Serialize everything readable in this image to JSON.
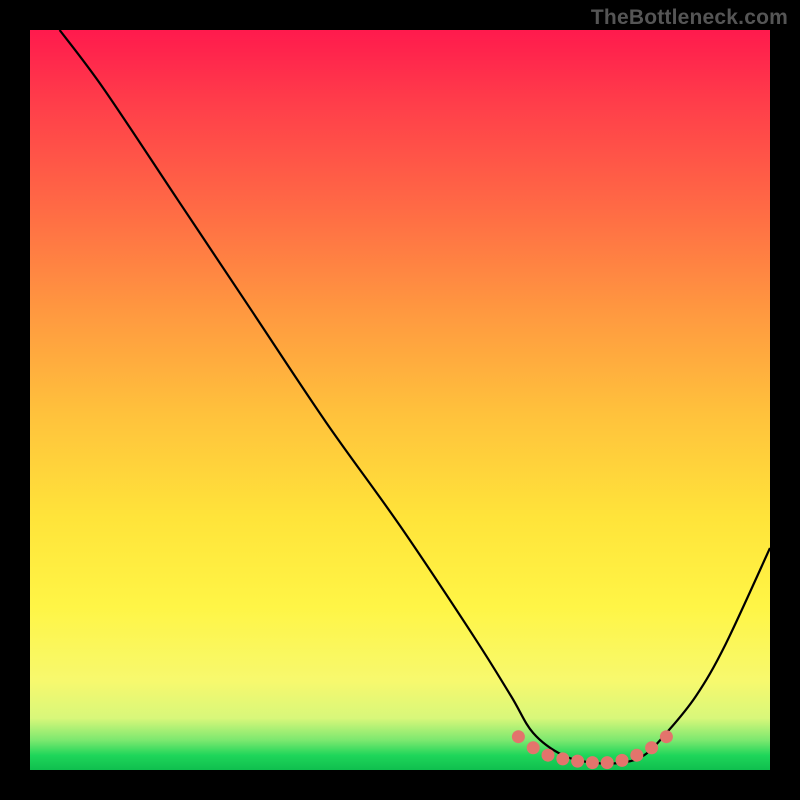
{
  "watermark": "TheBottleneck.com",
  "colors": {
    "background": "#000000",
    "curve_stroke": "#000000",
    "marker_fill": "#e3746c",
    "marker_stroke": "#e3746c"
  },
  "chart_data": {
    "type": "line",
    "title": "",
    "xlabel": "",
    "ylabel": "",
    "xlim": [
      0,
      100
    ],
    "ylim": [
      0,
      100
    ],
    "grid": false,
    "series": [
      {
        "name": "bottleneck-curve",
        "x": [
          4,
          10,
          20,
          30,
          40,
          50,
          60,
          65,
          68,
          72,
          76,
          80,
          83,
          86,
          90,
          94,
          100
        ],
        "y": [
          100,
          92,
          77,
          62,
          47,
          33,
          18,
          10,
          5,
          2,
          1,
          1,
          2,
          5,
          10,
          17,
          30
        ]
      }
    ],
    "markers": {
      "name": "optimal-zone",
      "points": [
        {
          "x": 66,
          "y": 4.5
        },
        {
          "x": 68,
          "y": 3.0
        },
        {
          "x": 70,
          "y": 2.0
        },
        {
          "x": 72,
          "y": 1.5
        },
        {
          "x": 74,
          "y": 1.2
        },
        {
          "x": 76,
          "y": 1.0
        },
        {
          "x": 78,
          "y": 1.0
        },
        {
          "x": 80,
          "y": 1.3
        },
        {
          "x": 82,
          "y": 2.0
        },
        {
          "x": 84,
          "y": 3.0
        },
        {
          "x": 86,
          "y": 4.5
        }
      ]
    }
  }
}
